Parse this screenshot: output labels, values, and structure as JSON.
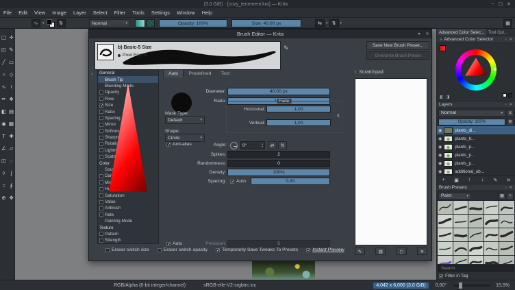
{
  "window": {
    "title": "(3.0 GiB) - [cozy_tenement.kra] — Krita",
    "controls": {
      "minimize": "–",
      "maximize": "▢",
      "close": "✕"
    }
  },
  "menubar": {
    "items": [
      "File",
      "Edit",
      "View",
      "Image",
      "Layer",
      "Select",
      "Filter",
      "Tools",
      "Settings",
      "Window",
      "Help"
    ]
  },
  "toolbar": {
    "blending_mode": "Normal",
    "opacity": {
      "label": "Opacity: 100%",
      "fill": 100
    },
    "size": {
      "label": "Size: 40,00 px",
      "fill": 100
    },
    "accent_color": "#5d86a8"
  },
  "toolbox": {
    "tools": [
      {
        "name": "transform",
        "glyph": "▢"
      },
      {
        "name": "move",
        "glyph": "✛"
      },
      {
        "name": "crop",
        "glyph": "◰"
      },
      {
        "name": "freehand-brush",
        "glyph": "✎"
      },
      {
        "name": "line",
        "glyph": "╱"
      },
      {
        "name": "rectangle",
        "glyph": "▭"
      },
      {
        "name": "ellipse",
        "glyph": "○"
      },
      {
        "name": "polygon",
        "glyph": "◇"
      },
      {
        "name": "polyline",
        "glyph": "∿"
      },
      {
        "name": "bezier-curve",
        "glyph": "≀"
      },
      {
        "name": "dynamic-brush",
        "glyph": "✏"
      },
      {
        "name": "multibrush",
        "glyph": "❖"
      },
      {
        "name": "fill",
        "glyph": "◧"
      },
      {
        "name": "gradient",
        "glyph": "▤"
      },
      {
        "name": "color-sampler",
        "glyph": "◉"
      },
      {
        "name": "pattern-edit",
        "glyph": "▦"
      },
      {
        "name": "text",
        "glyph": "T"
      },
      {
        "name": "assistants",
        "glyph": "✚"
      },
      {
        "name": "measure",
        "glyph": "∠"
      },
      {
        "name": "reference-images",
        "glyph": "▱"
      },
      {
        "name": "rectangular-selection",
        "glyph": "◫"
      },
      {
        "name": "elliptical-selection",
        "glyph": "◌"
      },
      {
        "name": "polygonal-selection",
        "glyph": "◊"
      },
      {
        "name": "freehand-selection",
        "glyph": "∫"
      },
      {
        "name": "similar-color-selection",
        "glyph": "≈"
      },
      {
        "name": "bezier-selection",
        "glyph": "∮"
      },
      {
        "name": "zoom",
        "glyph": "⊕"
      },
      {
        "name": "pan",
        "glyph": "✥"
      }
    ]
  },
  "dialog": {
    "title": "Brush Editor — Krita",
    "preset": {
      "name": "b) Basic-5 Size",
      "engine": "Pixel Engine"
    },
    "buttons": {
      "save_new": "Save New Brush Preset...",
      "overwrite": "Overwrite Brush Preset"
    },
    "tabs": {
      "auto": "Auto",
      "predefined": "Predefined",
      "text": "Text"
    },
    "options": [
      {
        "type": "header",
        "label": "General"
      },
      {
        "type": "item",
        "label": "Brush Tip",
        "selected": true
      },
      {
        "type": "item",
        "label": "Blending Mode"
      },
      {
        "type": "item",
        "label": "Opacity",
        "check": "unchecked"
      },
      {
        "type": "item",
        "label": "Flow",
        "check": "unchecked"
      },
      {
        "type": "item",
        "label": "Size",
        "check": "checked"
      },
      {
        "type": "item",
        "label": "Ratio",
        "check": "unchecked"
      },
      {
        "type": "item",
        "label": "Spacing",
        "check": "unchecked"
      },
      {
        "type": "item",
        "label": "Mirror",
        "check": "unchecked"
      },
      {
        "type": "item",
        "label": "Softness",
        "check": "unchecked"
      },
      {
        "type": "item",
        "label": "Sharpness",
        "check": "unchecked"
      },
      {
        "type": "item",
        "label": "Rotation",
        "check": "unchecked"
      },
      {
        "type": "item",
        "label": "Lightness Str...",
        "check": "unchecked"
      },
      {
        "type": "item",
        "label": "Scatter",
        "check": "unchecked"
      },
      {
        "type": "header",
        "label": "Color"
      },
      {
        "type": "item",
        "label": "Source"
      },
      {
        "type": "item",
        "label": "Darken",
        "check": "unchecked"
      },
      {
        "type": "item",
        "label": "Mix",
        "check": "unchecked"
      },
      {
        "type": "item",
        "label": "Hue",
        "check": "unchecked"
      },
      {
        "type": "item",
        "label": "Saturation",
        "check": "unchecked"
      },
      {
        "type": "item",
        "label": "Value",
        "check": "unchecked"
      },
      {
        "type": "item",
        "label": "Airbrush",
        "check": "unchecked"
      },
      {
        "type": "item",
        "label": "Rate",
        "check": "unchecked"
      },
      {
        "type": "item",
        "label": "Painting Mode"
      },
      {
        "type": "header",
        "label": "Texture"
      },
      {
        "type": "item",
        "label": "Pattern",
        "check": "unchecked"
      },
      {
        "type": "item",
        "label": "Strength",
        "check": "unchecked"
      }
    ],
    "settings": {
      "diameter": {
        "label": "Diameter:",
        "value": "40,00 px",
        "fill": 100
      },
      "ratio": {
        "label": "Ratio:",
        "value": "1,00",
        "fill": 100
      },
      "fade_title": "Fade",
      "fade_h": {
        "label": "Horizontal:",
        "value": "1,00",
        "fill": 100
      },
      "fade_v": {
        "label": "Vertical:",
        "value": "1,00",
        "fill": 100
      },
      "mask_type_label": "Mask Type:",
      "mask_type_value": "Default",
      "shape_label": "Shape:",
      "shape_value": "Circle",
      "angle_label": "Angle:",
      "angle_value": "0°",
      "antialias_label": "Anti-alias",
      "spikes": {
        "label": "Spikes:",
        "value": "2",
        "fill": 0
      },
      "randomness": {
        "label": "Randomness:",
        "value": "0",
        "fill": 0
      },
      "density": {
        "label": "Density:",
        "value": "100%",
        "fill": 100
      },
      "spacing_auto_label": "Auto",
      "spacing": {
        "label": "Spacing:",
        "value": "0,80",
        "fill": 100
      },
      "auto_precision_label": "Auto",
      "precision": {
        "label": "Precision:",
        "value": "5",
        "fill": 0,
        "disabled": true
      }
    },
    "footer": [
      {
        "label": "Eraser switch size",
        "checked": false
      },
      {
        "label": "Eraser switch opacity",
        "checked": false
      },
      {
        "label": "Temporarily Save Tweaks To Presets",
        "checked": true
      },
      {
        "label": "Instant Preview",
        "checked": true,
        "underlined": true
      }
    ],
    "scratchpad": {
      "title": "Scratchpad",
      "actions": [
        {
          "name": "fill-scratchpad-brush",
          "glyph": "✎"
        },
        {
          "name": "fill-scratchpad-gradient",
          "glyph": "▤"
        },
        {
          "name": "fill-scratchpad-background",
          "glyph": "◻"
        },
        {
          "name": "clear-scratchpad",
          "glyph": "✕"
        }
      ]
    }
  },
  "dockers": {
    "tabs": [
      "Advanced Color Selec...",
      "Tool Opt..."
    ],
    "color_selector": {
      "title": "Advanced Color Selector",
      "current_color": "#ec1c1c"
    },
    "layers": {
      "title": "Layers",
      "blending_mode": "Normal",
      "opacity": {
        "label": "Opacity: 100%",
        "fill": 100
      },
      "items": [
        {
          "name": "plants_di...",
          "selected": true
        },
        {
          "name": "plants_tr..."
        },
        {
          "name": "plants_p..."
        },
        {
          "name": "plants_p..."
        },
        {
          "name": "plants_p..."
        },
        {
          "name": "additional_ob..."
        }
      ],
      "actions": [
        {
          "name": "add-layer",
          "glyph": "+"
        },
        {
          "name": "duplicate-layer",
          "glyph": "▣"
        },
        {
          "name": "move-layer-up",
          "glyph": "↑"
        },
        {
          "name": "move-layer-down",
          "glyph": "↓"
        },
        {
          "name": "layer-properties",
          "glyph": "✎"
        },
        {
          "name": "delete-layer",
          "glyph": "✕"
        }
      ]
    },
    "brush_presets": {
      "title": "Brush Presets",
      "tag_filter": "Paint",
      "grid": {
        "count": 25,
        "columns": 5,
        "stroke_color": "#2b2b2b",
        "accent_index": 20,
        "accent_color": "#7a4fd0"
      },
      "search_placeholder": "Search",
      "filter_label": "Filter in Tag",
      "filter_checked": true
    }
  },
  "statusbar": {
    "colorspace": "RGB/Alpha (8-bit integer/channel)",
    "profile": "sRGB-elle-V2-srgbtrc.icc",
    "dimensions": "4,042 x 6,000 (3.0 GiB)",
    "angle": "0,00°",
    "zoom": "15,5%"
  }
}
